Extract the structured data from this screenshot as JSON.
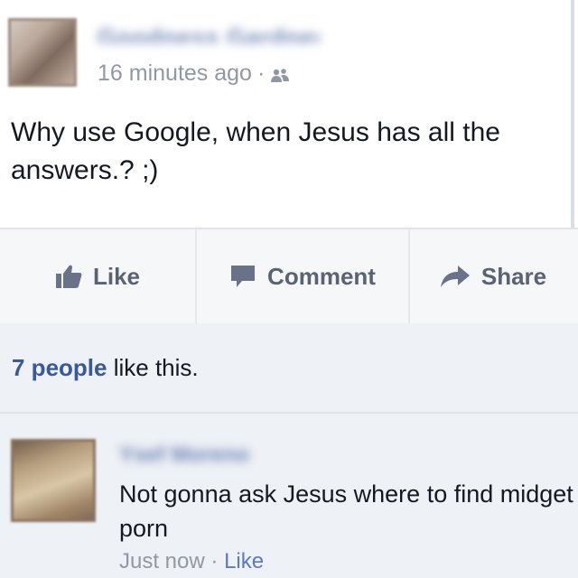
{
  "post": {
    "author": "Goodness Gardner",
    "timestamp": "16 minutes ago",
    "separator": "·",
    "audience_icon": "friends-icon",
    "text": "Why use Google, when Jesus has all the answers.? ;)"
  },
  "actions": {
    "like_label": "Like",
    "comment_label": "Comment",
    "share_label": "Share",
    "icons": [
      "thumbs-up-icon",
      "comment-bubble-icon",
      "share-arrow-icon"
    ]
  },
  "likes": {
    "count_text": "7 people",
    "suffix": " like this."
  },
  "comment": {
    "author": "Ysef Moreno",
    "text": "Not gonna ask Jesus where to find midget porn",
    "timestamp": "Just now",
    "separator": "·",
    "like_label": "Like"
  },
  "colors": {
    "link": "#3b5998",
    "meta": "#9197a3",
    "text": "#141823",
    "action_bar": "#f6f7f9",
    "comment_bg": "#eef1f6"
  }
}
